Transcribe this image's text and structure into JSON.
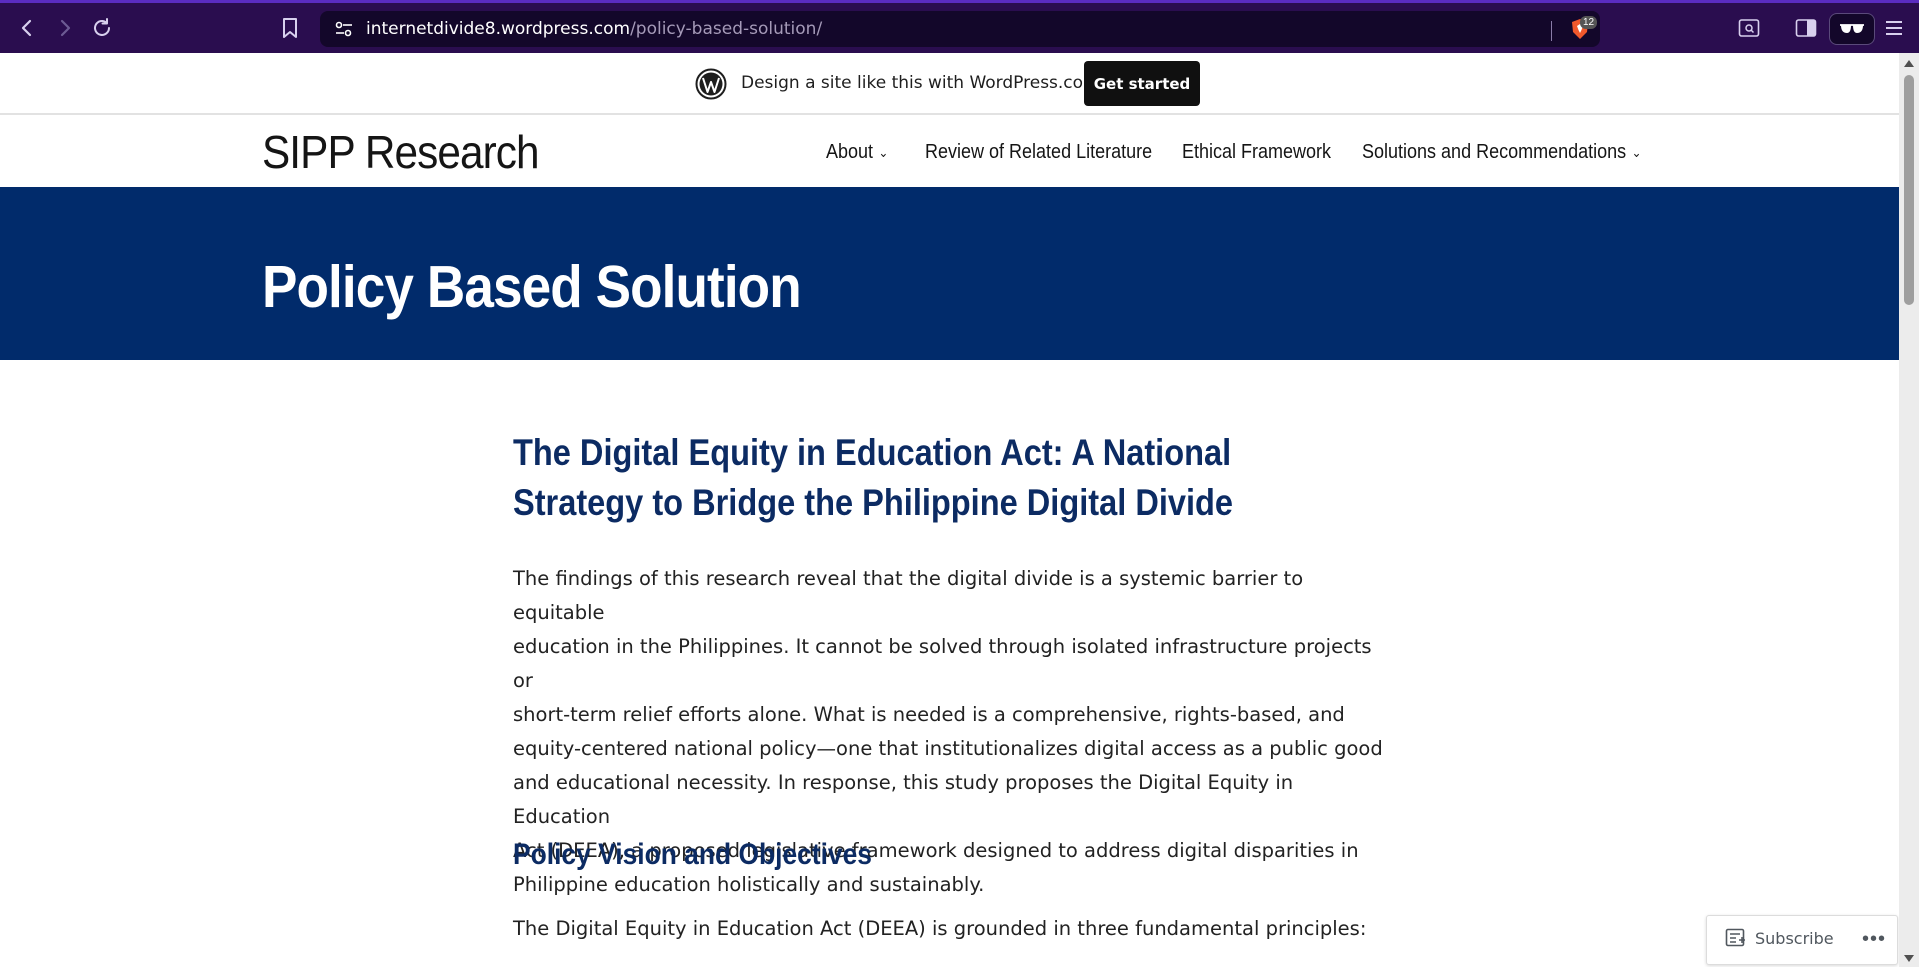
{
  "browser": {
    "url_host": "internetdivide8.wordpress.com",
    "url_path": "/policy-based-solution/",
    "shields_count": "12"
  },
  "wp_banner": {
    "text": "Design a site like this with WordPress.com",
    "cta_label": "Get started"
  },
  "site": {
    "title": "SIPP Research",
    "menu": [
      {
        "label": "About",
        "has_submenu": true
      },
      {
        "label": "Review of Related Literature",
        "has_submenu": false
      },
      {
        "label": "Ethical Framework",
        "has_submenu": false
      },
      {
        "label": "Solutions and Recommendations",
        "has_submenu": true
      }
    ]
  },
  "page": {
    "title": "Policy Based Solution",
    "heading": "The Digital Equity in Education Act: A National Strategy to Bridge the Philippine Digital Divide",
    "paragraph_lines": [
      "The findings of this research reveal that the digital divide is a systemic barrier to equitable",
      "education in the Philippines. It cannot be solved through isolated infrastructure projects or",
      "short-term relief efforts alone. What is needed is a comprehensive, rights-based, and",
      "equity-centered national policy—one that institutionalizes digital access as a public good",
      "and educational necessity. In response, this study proposes the Digital Equity in Education",
      "Act (DEEA), a proposed legislative framework designed to address digital disparities in",
      "Philippine education holistically and sustainably."
    ],
    "subheading": "Policy Vision and Objectives",
    "paragraph2": "The Digital Equity in Education Act (DEEA) is grounded in three fundamental principles:"
  },
  "subscribe": {
    "label": "Subscribe",
    "more": "•••"
  },
  "colors": {
    "browser_bar": "#2a0d4f",
    "hero_bg": "#012b6b",
    "heading_color": "#0c2b63"
  }
}
